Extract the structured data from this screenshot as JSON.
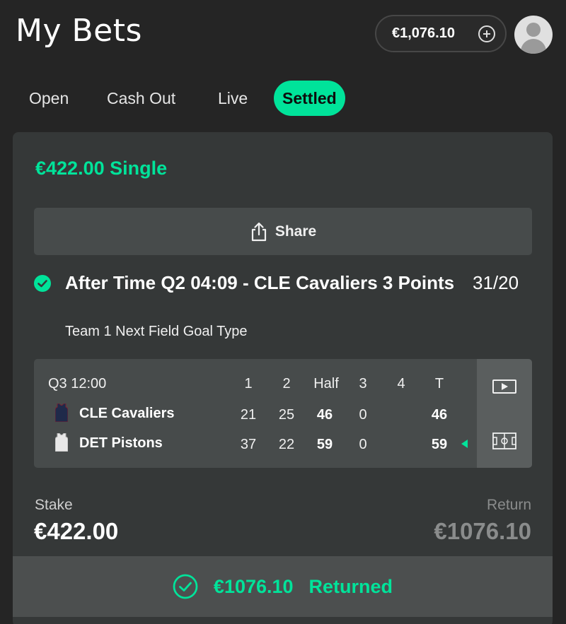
{
  "header": {
    "title": "My Bets",
    "balance": "€1,076.10",
    "balance_icon": "plus-circle-icon",
    "avatar_icon": "user-avatar-icon"
  },
  "tabs": [
    {
      "label": "Open",
      "active": false
    },
    {
      "label": "Cash Out",
      "active": false
    },
    {
      "label": "Live",
      "active": false
    },
    {
      "label": "Settled",
      "active": true
    }
  ],
  "colors": {
    "accent": "#00e39a",
    "background": "#252525",
    "card": "#353838",
    "panel": "#474b4b",
    "muted": "#8a8c8c"
  },
  "bet": {
    "title": "€422.00 Single",
    "share_label": "Share",
    "share_icon": "share-icon",
    "status_icon": "check-circle-icon",
    "selection": "After Time Q2 04:09 - CLE Cavaliers 3 Points",
    "odds": "31/20",
    "market": "Team 1 Next Field Goal Type",
    "stake_label": "Stake",
    "stake_value": "€422.00",
    "return_label": "Return",
    "return_value": "€1076.10",
    "returned_amount": "€1076.10",
    "returned_label": "Returned"
  },
  "scoreboard": {
    "period": "Q3 12:00",
    "columns": [
      "1",
      "2",
      "Half",
      "3",
      "4",
      "T"
    ],
    "teams": [
      {
        "name": "CLE Cavaliers",
        "jersey_color": "#1f2a4a",
        "q1": "21",
        "q2": "25",
        "half": "46",
        "q3": "0",
        "q4": "",
        "total": "46",
        "leading": false
      },
      {
        "name": "DET Pistons",
        "jersey_color": "#e8e8e8",
        "q1": "37",
        "q2": "22",
        "half": "59",
        "q3": "0",
        "q4": "",
        "total": "59",
        "leading": true
      }
    ],
    "side_icons": [
      "play-video-icon",
      "court-stats-icon"
    ]
  }
}
